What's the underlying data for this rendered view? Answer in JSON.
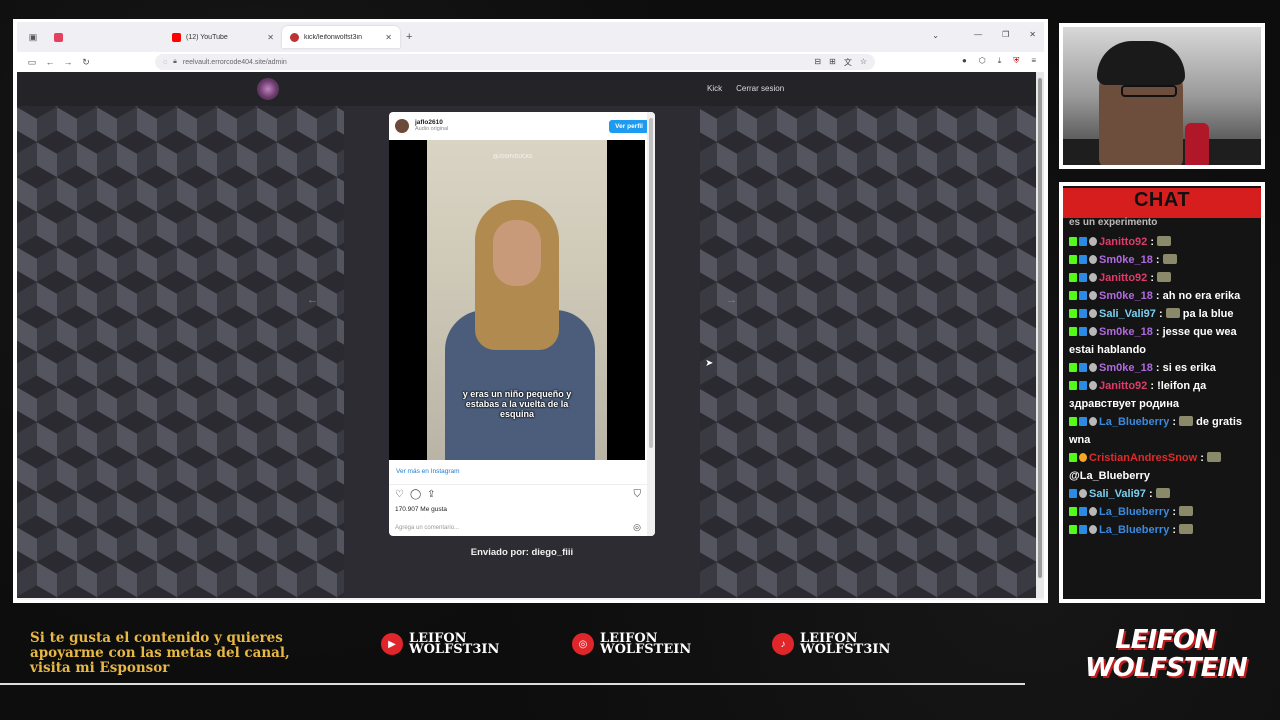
{
  "browser": {
    "tabs": [
      {
        "label": "",
        "favicon_color": "#e4405f"
      },
      {
        "label": "(12) YouTube",
        "favicon_color": "#ff0000"
      },
      {
        "label": "kick/leifonwolfst3in",
        "favicon_color": "#b33"
      }
    ],
    "url": "reelvault.errorcode404.site/admin",
    "url_domain": "errorcode404.site"
  },
  "site": {
    "nav": [
      "Kick",
      "Cerrar sesion"
    ]
  },
  "instagram": {
    "username": "jaflo2610",
    "audio": "Audio original",
    "follow_label": "Ver perfil",
    "watermark": "@JOSHVDUCKS",
    "caption": "y eras un niño pequeño y estabas a la vuelta de la esquina",
    "see_more": "Ver más en Instagram",
    "likes": "170.907 Me gusta",
    "comment_placeholder": "Agrega un comentario..."
  },
  "sent_by": "Enviado por: diego_fiii",
  "chat": {
    "title": "CHAT",
    "cut_line": "es un experimento",
    "messages": [
      {
        "user": "Janitto92",
        "color": "#e03a6a",
        "text": "",
        "badges": [
          "green",
          "blue",
          "gray"
        ],
        "emote": true
      },
      {
        "user": "Sm0ke_18",
        "color": "#b06ae0",
        "text": "",
        "badges": [
          "green",
          "blue",
          "gray"
        ],
        "emote": true
      },
      {
        "user": "Janitto92",
        "color": "#e03a6a",
        "text": "",
        "badges": [
          "green",
          "blue",
          "gray"
        ],
        "emote": true
      },
      {
        "user": "Sm0ke_18",
        "color": "#b06ae0",
        "text": "ah no era erika",
        "badges": [
          "green",
          "blue",
          "gray"
        ],
        "emote": false
      },
      {
        "user": "Sali_Vali97",
        "color": "#7ad0f0",
        "text": "pa la blue",
        "badges": [
          "green",
          "blue",
          "gray"
        ],
        "emote": true
      },
      {
        "user": "Sm0ke_18",
        "color": "#b06ae0",
        "text": "jesse que wea estai hablando",
        "badges": [
          "green",
          "blue",
          "gray"
        ],
        "emote": false
      },
      {
        "user": "Sm0ke_18",
        "color": "#b06ae0",
        "text": "si es erika",
        "badges": [
          "green",
          "blue",
          "gray"
        ],
        "emote": false
      },
      {
        "user": "Janitto92",
        "color": "#e03a6a",
        "text": "!leifon да здравствует родина",
        "badges": [
          "green",
          "blue",
          "gray"
        ],
        "emote": false
      },
      {
        "user": "La_Blueberry",
        "color": "#3a8ae0",
        "text": "de gratis wna",
        "badges": [
          "green",
          "blue",
          "gray"
        ],
        "emote": true
      },
      {
        "user": "CristianAndresSnow",
        "color": "#e02a2a",
        "text": "@La_Blueberry",
        "badges": [
          "green",
          "orange"
        ],
        "emote": true
      },
      {
        "user": "Sali_Vali97",
        "color": "#7ad0f0",
        "text": "",
        "badges": [
          "blue",
          "gray"
        ],
        "emote": true
      },
      {
        "user": "La_Blueberry",
        "color": "#3a8ae0",
        "text": "",
        "badges": [
          "green",
          "blue",
          "gray"
        ],
        "emote": true
      },
      {
        "user": "La_Blueberry",
        "color": "#3a8ae0",
        "text": "",
        "badges": [
          "green",
          "blue",
          "gray"
        ],
        "emote": true
      }
    ]
  },
  "footer": {
    "sponsor_text": "Si te gusta el contenido y quieres apoyarme con las metas del canal, visita mi Esponsor",
    "socials": [
      {
        "platform": "youtube",
        "icon": "youtube-icon",
        "line1": "LEIFON",
        "line2": "WOLFST3IN"
      },
      {
        "platform": "instagram",
        "icon": "instagram-icon",
        "line1": "LEIFON",
        "line2": "WOLFSTEIN"
      },
      {
        "platform": "tiktok",
        "icon": "tiktok-icon",
        "line1": "LEIFON",
        "line2": "WOLFST3IN"
      }
    ],
    "brand_line1": "LEIFON",
    "brand_line2": "WOLFSTEIN"
  }
}
